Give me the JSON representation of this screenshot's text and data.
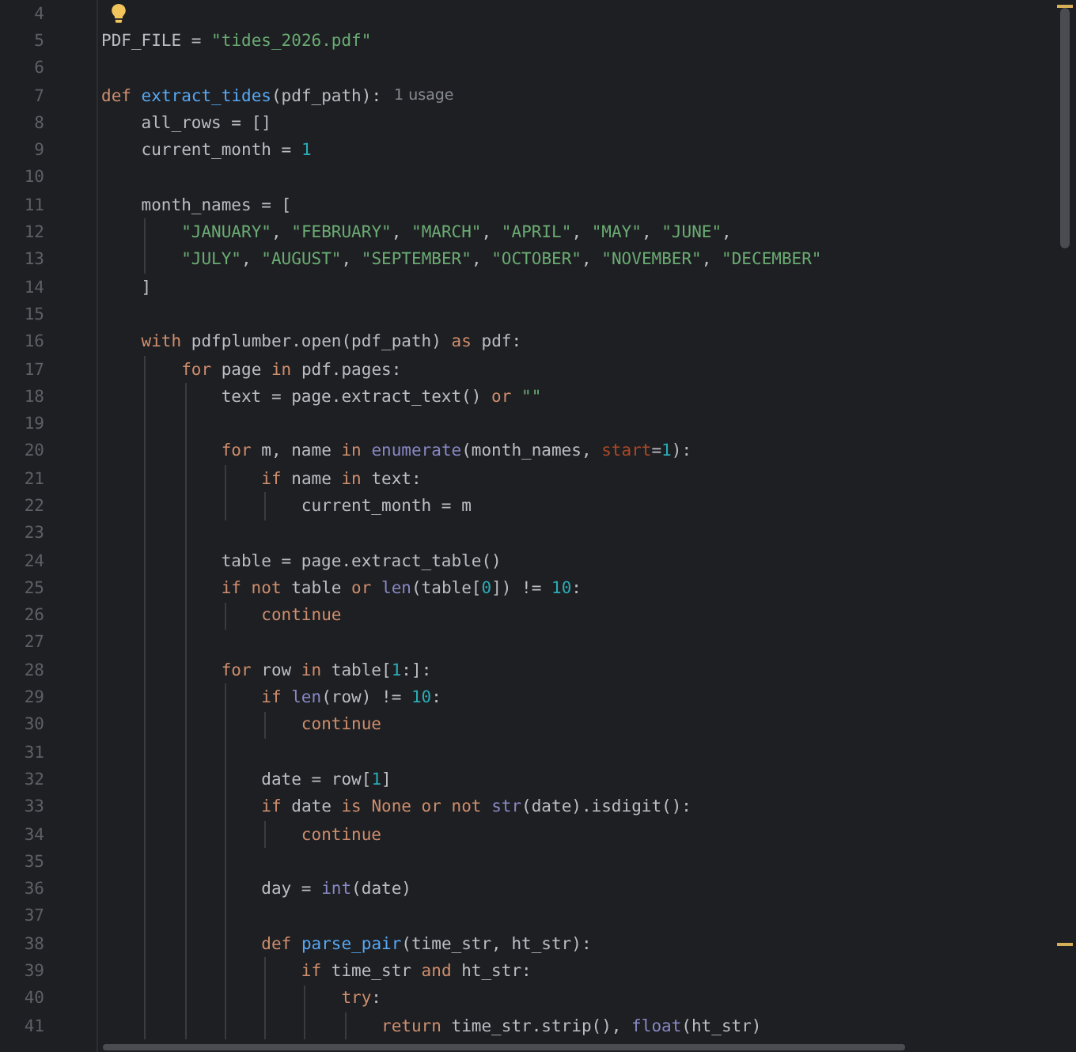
{
  "editor": {
    "lines": [
      {
        "number": "4"
      },
      {
        "number": "5",
        "tokens": [
          {
            "text": "PDF_FILE = ",
            "kind": "plain"
          },
          {
            "text": "\"tides_2026.pdf\"",
            "kind": "string"
          }
        ]
      },
      {
        "number": "6"
      },
      {
        "number": "7",
        "tokens": [
          {
            "text": "def ",
            "kind": "keyword"
          },
          {
            "text": "extract_tides",
            "kind": "function"
          },
          {
            "text": "(pdf_path):",
            "kind": "plain"
          },
          {
            "text": "1 usage",
            "kind": "hint"
          }
        ]
      },
      {
        "number": "8",
        "tokens": [
          {
            "text": "    all_rows = []",
            "kind": "plain"
          }
        ]
      },
      {
        "number": "9",
        "tokens": [
          {
            "text": "    current_month = ",
            "kind": "plain"
          },
          {
            "text": "1",
            "kind": "number"
          }
        ]
      },
      {
        "number": "10"
      },
      {
        "number": "11",
        "tokens": [
          {
            "text": "    month_names = [",
            "kind": "plain"
          }
        ]
      },
      {
        "number": "12",
        "tokens": [
          {
            "text": "        \"JANUARY\"",
            "kind": "string"
          },
          {
            "text": ", ",
            "kind": "plain"
          },
          {
            "text": "\"FEBRUARY\"",
            "kind": "string"
          },
          {
            "text": ", ",
            "kind": "plain"
          },
          {
            "text": "\"MARCH\"",
            "kind": "string"
          },
          {
            "text": ", ",
            "kind": "plain"
          },
          {
            "text": "\"APRIL\"",
            "kind": "string"
          },
          {
            "text": ", ",
            "kind": "plain"
          },
          {
            "text": "\"MAY\"",
            "kind": "string"
          },
          {
            "text": ", ",
            "kind": "plain"
          },
          {
            "text": "\"JUNE\"",
            "kind": "string"
          },
          {
            "text": ",",
            "kind": "plain"
          }
        ]
      },
      {
        "number": "13",
        "tokens": [
          {
            "text": "        \"JULY\"",
            "kind": "string"
          },
          {
            "text": ", ",
            "kind": "plain"
          },
          {
            "text": "\"AUGUST\"",
            "kind": "string"
          },
          {
            "text": ", ",
            "kind": "plain"
          },
          {
            "text": "\"SEPTEMBER\"",
            "kind": "string"
          },
          {
            "text": ", ",
            "kind": "plain"
          },
          {
            "text": "\"OCTOBER\"",
            "kind": "string"
          },
          {
            "text": ", ",
            "kind": "plain"
          },
          {
            "text": "\"NOVEMBER\"",
            "kind": "string"
          },
          {
            "text": ", ",
            "kind": "plain"
          },
          {
            "text": "\"DECEMBER\"",
            "kind": "string"
          }
        ]
      },
      {
        "number": "14",
        "tokens": [
          {
            "text": "    ]",
            "kind": "plain"
          }
        ]
      },
      {
        "number": "15"
      },
      {
        "number": "16",
        "tokens": [
          {
            "text": "    with",
            "kind": "keyword"
          },
          {
            "text": " pdfplumber.open(pdf_path) ",
            "kind": "plain"
          },
          {
            "text": "as",
            "kind": "keyword"
          },
          {
            "text": " pdf:",
            "kind": "plain"
          }
        ]
      },
      {
        "number": "17",
        "tokens": [
          {
            "text": "        for",
            "kind": "keyword"
          },
          {
            "text": " page ",
            "kind": "plain"
          },
          {
            "text": "in",
            "kind": "keyword"
          },
          {
            "text": " pdf.pages:",
            "kind": "plain"
          }
        ]
      },
      {
        "number": "18",
        "tokens": [
          {
            "text": "            text = page.extract_text() ",
            "kind": "plain"
          },
          {
            "text": "or ",
            "kind": "keyword"
          },
          {
            "text": "\"\"",
            "kind": "string"
          }
        ]
      },
      {
        "number": "19"
      },
      {
        "number": "20",
        "tokens": [
          {
            "text": "            for",
            "kind": "keyword"
          },
          {
            "text": " m, name ",
            "kind": "plain"
          },
          {
            "text": "in ",
            "kind": "keyword"
          },
          {
            "text": "enumerate",
            "kind": "builtin"
          },
          {
            "text": "(month_names, ",
            "kind": "plain"
          },
          {
            "text": "start",
            "kind": "argument"
          },
          {
            "text": "=",
            "kind": "plain"
          },
          {
            "text": "1",
            "kind": "number"
          },
          {
            "text": "):",
            "kind": "plain"
          }
        ]
      },
      {
        "number": "21",
        "tokens": [
          {
            "text": "                if",
            "kind": "keyword"
          },
          {
            "text": " name ",
            "kind": "plain"
          },
          {
            "text": "in",
            "kind": "keyword"
          },
          {
            "text": " text:",
            "kind": "plain"
          }
        ]
      },
      {
        "number": "22",
        "tokens": [
          {
            "text": "                    current_month = m",
            "kind": "plain"
          }
        ]
      },
      {
        "number": "23"
      },
      {
        "number": "24",
        "tokens": [
          {
            "text": "            table = page.extract_table()",
            "kind": "plain"
          }
        ]
      },
      {
        "number": "25",
        "tokens": [
          {
            "text": "            if not",
            "kind": "keyword"
          },
          {
            "text": " table ",
            "kind": "plain"
          },
          {
            "text": "or ",
            "kind": "keyword"
          },
          {
            "text": "len",
            "kind": "builtin"
          },
          {
            "text": "(table[",
            "kind": "plain"
          },
          {
            "text": "0",
            "kind": "number"
          },
          {
            "text": "]) != ",
            "kind": "plain"
          },
          {
            "text": "10",
            "kind": "number"
          },
          {
            "text": ":",
            "kind": "plain"
          }
        ]
      },
      {
        "number": "26",
        "tokens": [
          {
            "text": "                continue",
            "kind": "keyword"
          }
        ]
      },
      {
        "number": "27"
      },
      {
        "number": "28",
        "tokens": [
          {
            "text": "            for",
            "kind": "keyword"
          },
          {
            "text": " row ",
            "kind": "plain"
          },
          {
            "text": "in",
            "kind": "keyword"
          },
          {
            "text": " table[",
            "kind": "plain"
          },
          {
            "text": "1",
            "kind": "number"
          },
          {
            "text": ":]:",
            "kind": "plain"
          }
        ]
      },
      {
        "number": "29",
        "tokens": [
          {
            "text": "                if ",
            "kind": "keyword"
          },
          {
            "text": "len",
            "kind": "builtin"
          },
          {
            "text": "(row) != ",
            "kind": "plain"
          },
          {
            "text": "10",
            "kind": "number"
          },
          {
            "text": ":",
            "kind": "plain"
          }
        ]
      },
      {
        "number": "30",
        "tokens": [
          {
            "text": "                    continue",
            "kind": "keyword"
          }
        ]
      },
      {
        "number": "31"
      },
      {
        "number": "32",
        "tokens": [
          {
            "text": "                date = row[",
            "kind": "plain"
          },
          {
            "text": "1",
            "kind": "number"
          },
          {
            "text": "]",
            "kind": "plain"
          }
        ]
      },
      {
        "number": "33",
        "tokens": [
          {
            "text": "                if",
            "kind": "keyword"
          },
          {
            "text": " date ",
            "kind": "plain"
          },
          {
            "text": "is None or not ",
            "kind": "keyword"
          },
          {
            "text": "str",
            "kind": "builtin"
          },
          {
            "text": "(date).isdigit():",
            "kind": "plain"
          }
        ]
      },
      {
        "number": "34",
        "tokens": [
          {
            "text": "                    continue",
            "kind": "keyword"
          }
        ]
      },
      {
        "number": "35"
      },
      {
        "number": "36",
        "tokens": [
          {
            "text": "                day = ",
            "kind": "plain"
          },
          {
            "text": "int",
            "kind": "builtin"
          },
          {
            "text": "(date)",
            "kind": "plain"
          }
        ]
      },
      {
        "number": "37"
      },
      {
        "number": "38",
        "tokens": [
          {
            "text": "                def ",
            "kind": "keyword"
          },
          {
            "text": "parse_pair",
            "kind": "function"
          },
          {
            "text": "(time_str, ht_str):",
            "kind": "plain"
          }
        ]
      },
      {
        "number": "39",
        "tokens": [
          {
            "text": "                    if",
            "kind": "keyword"
          },
          {
            "text": " time_str ",
            "kind": "plain"
          },
          {
            "text": "and",
            "kind": "keyword"
          },
          {
            "text": " ht_str:",
            "kind": "plain"
          }
        ]
      },
      {
        "number": "40",
        "tokens": [
          {
            "text": "                        try",
            "kind": "keyword"
          },
          {
            "text": ":",
            "kind": "plain"
          }
        ]
      },
      {
        "number": "41",
        "tokens": [
          {
            "text": "                            return",
            "kind": "keyword"
          },
          {
            "text": " time_str.strip(), ",
            "kind": "plain"
          },
          {
            "text": "float",
            "kind": "builtin"
          },
          {
            "text": "(ht_str)",
            "kind": "plain"
          }
        ]
      }
    ]
  }
}
